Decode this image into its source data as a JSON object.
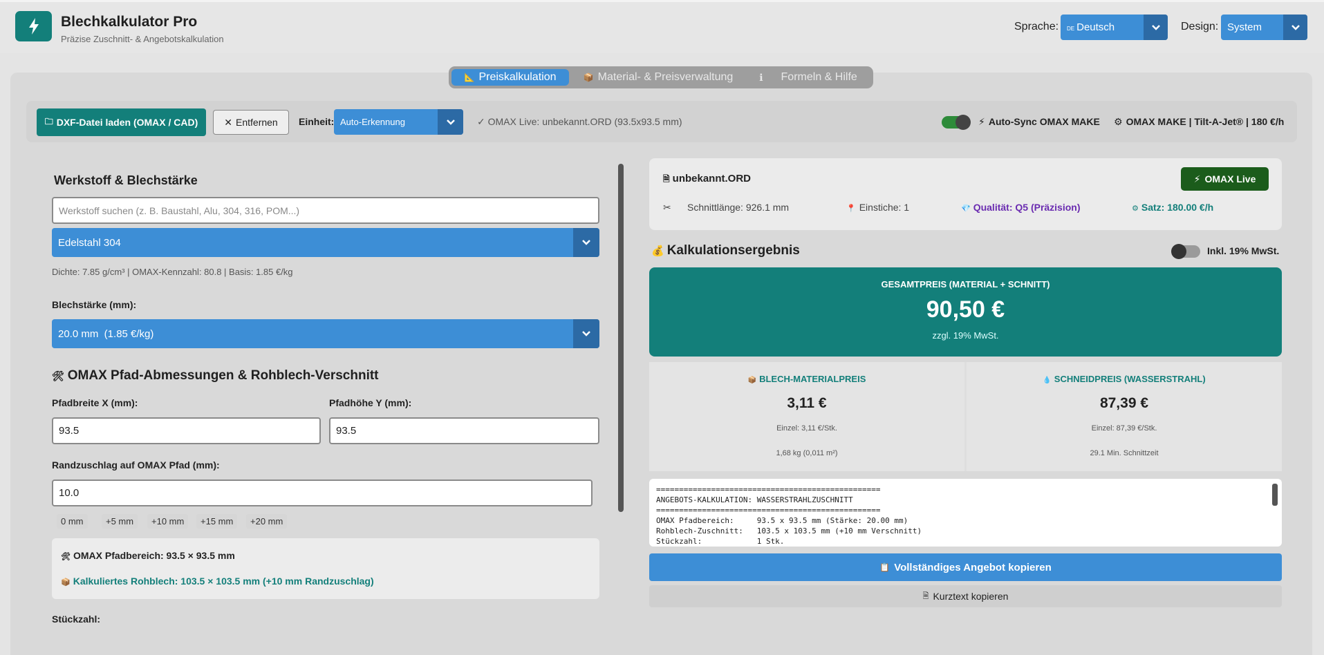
{
  "header": {
    "title": "Blechkalkulator Pro",
    "subtitle": "Präzise Zuschnitt- & Angebotskalkulation",
    "language_label": "Sprache:",
    "language_flag": "DE",
    "language_value": "Deutsch",
    "design_label": "Design:",
    "design_value": "System"
  },
  "tabs": [
    {
      "label": "Preiskalkulation",
      "active": true
    },
    {
      "label": "Material- & Preisverwaltung",
      "active": false
    },
    {
      "label": "Formeln & Hilfe",
      "active": false
    }
  ],
  "toolbar": {
    "load_dxf": "DXF-Datei laden (OMAX / CAD)",
    "remove": "Entfernen",
    "unit_label": "Einheit:",
    "unit_value": "Auto-Erkennung",
    "status": "✓ OMAX Live: unbekannt.ORD (93.5x93.5 mm)",
    "autosync_label": "Auto-Sync OMAX MAKE",
    "autosync_on": true,
    "machine": "OMAX MAKE | Tilt-A-Jet® | 180 €/h"
  },
  "material": {
    "heading": "Werkstoff & Blechstärke",
    "search_placeholder": "Werkstoff suchen (z. B. Baustahl, Alu, 304, 316, POM...)",
    "selected": "Edelstahl 304",
    "info": "Dichte: 7.85 g/cm³ | OMAX-Kennzahl: 80.8 | Basis: 1.85 €/kg",
    "thickness_label": "Blechstärke (mm):",
    "thickness_value": "20.0 mm  (1.85 €/kg)"
  },
  "path": {
    "heading": "OMAX Pfad-Abmessungen & Rohblech-Verschnitt",
    "width_label": "Pfadbreite X (mm):",
    "width_value": "93.5",
    "height_label": "Pfadhöhe Y (mm):",
    "height_value": "93.5",
    "margin_label": "Randzuschlag auf OMAX Pfad (mm):",
    "margin_value": "10.0",
    "chips": [
      "0 mm",
      "+5 mm",
      "+10 mm",
      "+15 mm",
      "+20 mm"
    ],
    "info_area": "OMAX Pfadbereich: 93.5 × 93.5 mm",
    "info_raw": "Kalkuliertes Rohblech: 103.5 × 103.5 mm (+10 mm Randzuschlag)",
    "quantity_label": "Stückzahl:"
  },
  "file_card": {
    "filename": "unbekannt.ORD",
    "live_button": "OMAX Live",
    "cut_length": "Schnittlänge: 926.1 mm",
    "pierces": "Einstiche: 1",
    "quality": "Qualität: Q5 (Präzision)",
    "rate": "Satz: 180.00 €/h"
  },
  "result": {
    "heading": "Kalkulationsergebnis",
    "vat_toggle_label": "Inkl. 19% MwSt.",
    "vat_on": false,
    "total_label": "GESAMTPREIS (MATERIAL + SCHNITT)",
    "total_value": "90,50 €",
    "total_note": "zzgl. 19% MwSt.",
    "material_label": "BLECH-MATERIALPREIS",
    "material_value": "3,11 €",
    "material_single": "Einzel: 3,11 €/Stk.",
    "material_weight": "1,68 kg (0,011 m²)",
    "cut_label": "SCHNEIDPREIS (WASSERSTRAHL)",
    "cut_value": "87,39 €",
    "cut_single": "Einzel: 87,39 €/Stk.",
    "cut_time": "29.1 Min. Schnittzeit"
  },
  "quote_text": "=================================================\nANGEBOTS-KALKULATION: WASSERSTRAHLZUSCHNITT\n=================================================\nOMAX Pfadbereich:     93.5 x 93.5 mm (Stärke: 20.00 mm)\nRohblech-Zuschnitt:   103.5 x 103.5 mm (+10 mm Verschnitt)\nStückzahl:            1 Stk.",
  "actions": {
    "copy_full": "Vollständiges Angebot kopieren",
    "copy_short": "Kurztext kopieren"
  },
  "colors": {
    "teal": "#137f7a",
    "blue": "#3d8ed6",
    "dark_green": "#1b5c1b",
    "purple": "#6a2bb0"
  }
}
